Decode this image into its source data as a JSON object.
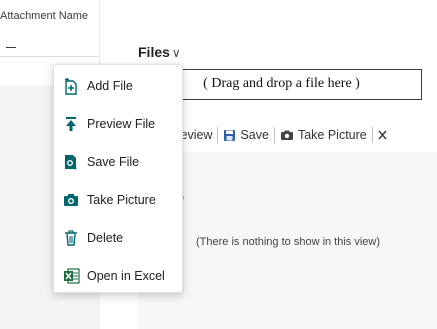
{
  "left_panel": {
    "column_header": "Attachment Name"
  },
  "factbox": {
    "title": "Files",
    "chevron": "∨",
    "dropzone_text": "( Drag and drop a file here )",
    "toolbar": {
      "preview_label": "Preview",
      "save_label": "Save",
      "take_picture_label": "Take Picture"
    },
    "column_header_fragment": "e",
    "empty_message": "(There is nothing to show in this view)"
  },
  "menu": {
    "items": [
      {
        "label": "Add File",
        "icon": "add-file-icon"
      },
      {
        "label": "Preview File",
        "icon": "upload-arrow-icon"
      },
      {
        "label": "Save File",
        "icon": "save-file-icon"
      },
      {
        "label": "Take Picture",
        "icon": "camera-icon"
      },
      {
        "label": "Delete",
        "icon": "trash-icon"
      },
      {
        "label": "Open in Excel",
        "icon": "excel-icon"
      }
    ]
  },
  "colors": {
    "accent_teal": "#00666e",
    "save_blue": "#2f5ea8",
    "excel_green": "#1e6e42"
  }
}
